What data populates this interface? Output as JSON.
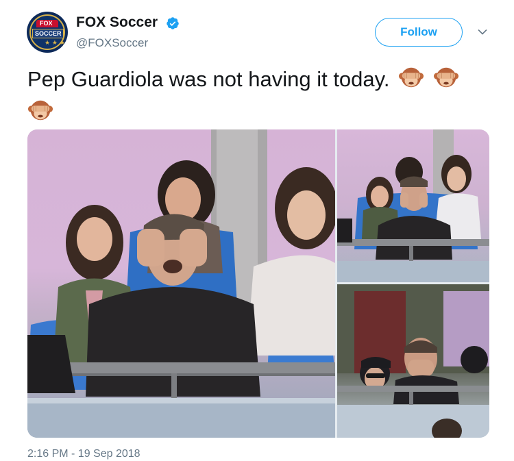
{
  "account": {
    "display_name": "FOX Soccer",
    "handle": "@FOXSoccer",
    "verified": true,
    "avatar_logo_top": "FOX",
    "avatar_logo_bottom": "SOCCER",
    "verified_icon": "verified-badge-icon"
  },
  "actions": {
    "follow_label": "Follow",
    "more_icon": "chevron-down-icon"
  },
  "tweet": {
    "text": "Pep Guardiola was not having it today.",
    "emoji_icon": "see-no-evil-monkey-icon",
    "emoji_count": 3
  },
  "media": {
    "photos": [
      {
        "position": "left-large",
        "subject": "man-covering-eyes-in-stand"
      },
      {
        "position": "top-right",
        "subject": "man-hands-on-face-in-stand"
      },
      {
        "position": "bottom-right",
        "subject": "man-hands-over-mouth-in-stand"
      }
    ]
  },
  "timestamp": "2:16 PM - 19 Sep 2018",
  "colors": {
    "brand_blue": "#1da1f2",
    "text_primary": "#14171a",
    "text_secondary": "#657786"
  }
}
